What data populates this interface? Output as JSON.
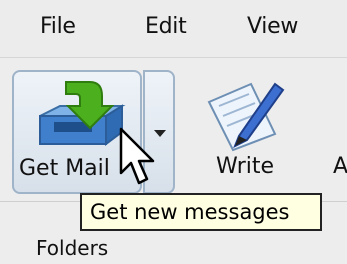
{
  "menubar": {
    "items": [
      {
        "label": "File"
      },
      {
        "label": "Edit"
      },
      {
        "label": "View"
      }
    ]
  },
  "toolbar": {
    "get_mail_label": "Get Mail",
    "write_label": "Write",
    "next_label_partial": "A"
  },
  "tooltip": {
    "text": "Get new messages"
  },
  "sidebar": {
    "folders_label": "Folders"
  },
  "icons": {
    "get_mail": "inbox-download-icon",
    "write": "write-pen-icon",
    "dropdown": "chevron-down-icon",
    "cursor": "mouse-pointer-icon"
  }
}
